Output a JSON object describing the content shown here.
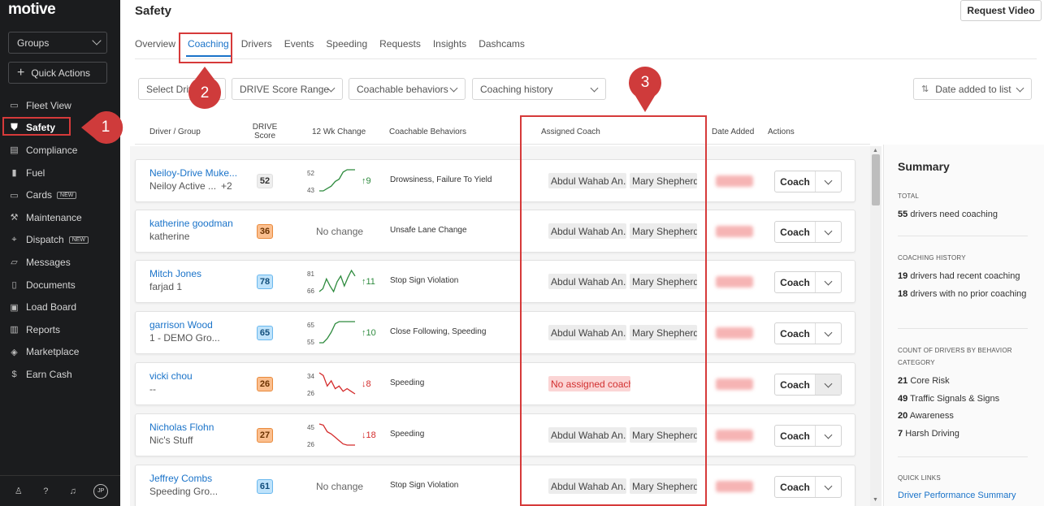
{
  "sidebar": {
    "logo": "motive",
    "groups_label": "Groups",
    "quick_actions_label": "Quick Actions",
    "items": [
      {
        "label": "Fleet View",
        "icon": "map-icon"
      },
      {
        "label": "Safety",
        "icon": "shield-icon",
        "active": true
      },
      {
        "label": "Compliance",
        "icon": "clipboard-icon"
      },
      {
        "label": "Fuel",
        "icon": "fuel-icon"
      },
      {
        "label": "Cards",
        "icon": "card-icon",
        "badge": "NEW"
      },
      {
        "label": "Maintenance",
        "icon": "wrench-icon"
      },
      {
        "label": "Dispatch",
        "icon": "pin-icon",
        "badge": "NEW"
      },
      {
        "label": "Messages",
        "icon": "chat-icon"
      },
      {
        "label": "Documents",
        "icon": "document-icon"
      },
      {
        "label": "Load Board",
        "icon": "truck-icon"
      },
      {
        "label": "Reports",
        "icon": "chart-icon"
      },
      {
        "label": "Marketplace",
        "icon": "cube-icon"
      },
      {
        "label": "Earn Cash",
        "icon": "dollar-icon"
      }
    ],
    "avatar_initials": "JP"
  },
  "header": {
    "title": "Safety",
    "request_video_label": "Request Video"
  },
  "tabs": [
    "Overview",
    "Coaching",
    "Drivers",
    "Events",
    "Speeding",
    "Requests",
    "Insights",
    "Dashcams"
  ],
  "filters": {
    "select_driver": "Select Driv",
    "drive_score_range": "DRIVE Score Range",
    "coachable_behaviors": "Coachable behaviors",
    "coaching_history": "Coaching history",
    "sort": "Date added to list"
  },
  "table": {
    "headers": {
      "driver_group": "Driver / Group",
      "drive_score_1": "DRIVE",
      "drive_score_2": "Score",
      "change": "12 Wk Change",
      "behaviors": "Coachable Behaviors",
      "assigned_coach": "Assigned Coach",
      "date_added": "Date Added",
      "actions": "Actions"
    },
    "coach_button_label": "Coach",
    "rows": [
      {
        "name": "Neiloy-Drive Muke...",
        "group": "Neiloy Active ...",
        "extra": "+2",
        "score": "52",
        "score_color": "grey",
        "spark": {
          "min": 43,
          "max": 52,
          "min_label": "43",
          "max_label": "52",
          "points": [
            43,
            43,
            44,
            45,
            47,
            48,
            51,
            52,
            52,
            52
          ],
          "delta": "↑9",
          "trend": "up"
        },
        "behaviors": "Drowsiness, Failure To Yield",
        "coach1": "Abdul Wahab An...",
        "coach2": "Mary Shepherd"
      },
      {
        "name": "katherine goodman",
        "group": "katherine",
        "extra": "",
        "score": "36",
        "score_color": "orange",
        "nochange": "No change",
        "behaviors": "Unsafe Lane Change",
        "coach1": "Abdul Wahab An...",
        "coach2": "Mary Shepherd"
      },
      {
        "name": "Mitch Jones",
        "group": "farjad 1",
        "extra": "",
        "score": "78",
        "score_color": "blue",
        "spark": {
          "min": 66,
          "max": 81,
          "min_label": "66",
          "max_label": "81",
          "points": [
            66,
            68,
            75,
            70,
            66,
            73,
            77,
            70,
            76,
            81,
            77
          ],
          "delta": "↑11",
          "trend": "up"
        },
        "behaviors": "Stop Sign Violation",
        "coach1": "Abdul Wahab An...",
        "coach2": "Mary Shepherd"
      },
      {
        "name": "garrison Wood",
        "group": "1 - DEMO Gro...",
        "extra": "",
        "score": "65",
        "score_color": "blue",
        "spark": {
          "min": 55,
          "max": 65,
          "min_label": "55",
          "max_label": "65",
          "points": [
            55,
            55,
            57,
            60,
            64,
            65,
            65,
            65,
            65,
            65
          ],
          "delta": "↑10",
          "trend": "up"
        },
        "behaviors": "Close Following, Speeding",
        "coach1": "Abdul Wahab An...",
        "coach2": "Mary Shepherd"
      },
      {
        "name": "vicki chou",
        "group": "--",
        "extra": "",
        "score": "26",
        "score_color": "orange",
        "spark": {
          "min": 26,
          "max": 34,
          "min_label": "26",
          "max_label": "34",
          "points": [
            34,
            33,
            29,
            31,
            28,
            29,
            27,
            28,
            27,
            26
          ],
          "delta": "↓8",
          "trend": "down"
        },
        "behaviors": "Speeding",
        "no_coach": "No assigned coach",
        "coach_dropdown_disabled": true
      },
      {
        "name": "Nicholas Flohn",
        "group": "Nic's Stuff",
        "extra": "",
        "score": "27",
        "score_color": "orange",
        "spark": {
          "min": 26,
          "max": 45,
          "min_label": "26",
          "max_label": "45",
          "points": [
            45,
            44,
            38,
            36,
            33,
            30,
            27,
            26,
            26,
            26
          ],
          "delta": "↓18",
          "trend": "down"
        },
        "behaviors": "Speeding",
        "coach1": "Abdul Wahab An...",
        "coach2": "Mary Shepherd"
      },
      {
        "name": "Jeffrey Combs",
        "group": "Speeding Gro...",
        "extra": "",
        "score": "61",
        "score_color": "blue",
        "nochange": "No change",
        "behaviors": "Stop Sign Violation",
        "coach1": "Abdul Wahab An...",
        "coach2": "Mary Shepherd"
      }
    ]
  },
  "summary": {
    "title": "Summary",
    "total_label": "TOTAL",
    "total_count": "55",
    "total_text": "drivers need coaching",
    "history_label": "COACHING HISTORY",
    "recent_count": "19",
    "recent_text": "drivers had recent coaching",
    "noprior_count": "18",
    "noprior_text": "drivers with no prior coaching",
    "category_label": "COUNT OF DRIVERS BY BEHAVIOR CATEGORY",
    "categories": [
      {
        "count": "21",
        "label": "Core Risk"
      },
      {
        "count": "49",
        "label": "Traffic Signals & Signs"
      },
      {
        "count": "20",
        "label": "Awareness"
      },
      {
        "count": "7",
        "label": "Harsh Driving"
      }
    ],
    "quick_links_label": "QUICK LINKS",
    "link_label": "Driver Performance Summary"
  },
  "annotations": {
    "marker_1": "1",
    "marker_2": "2",
    "marker_3": "3",
    "color": "#d63a3a"
  }
}
